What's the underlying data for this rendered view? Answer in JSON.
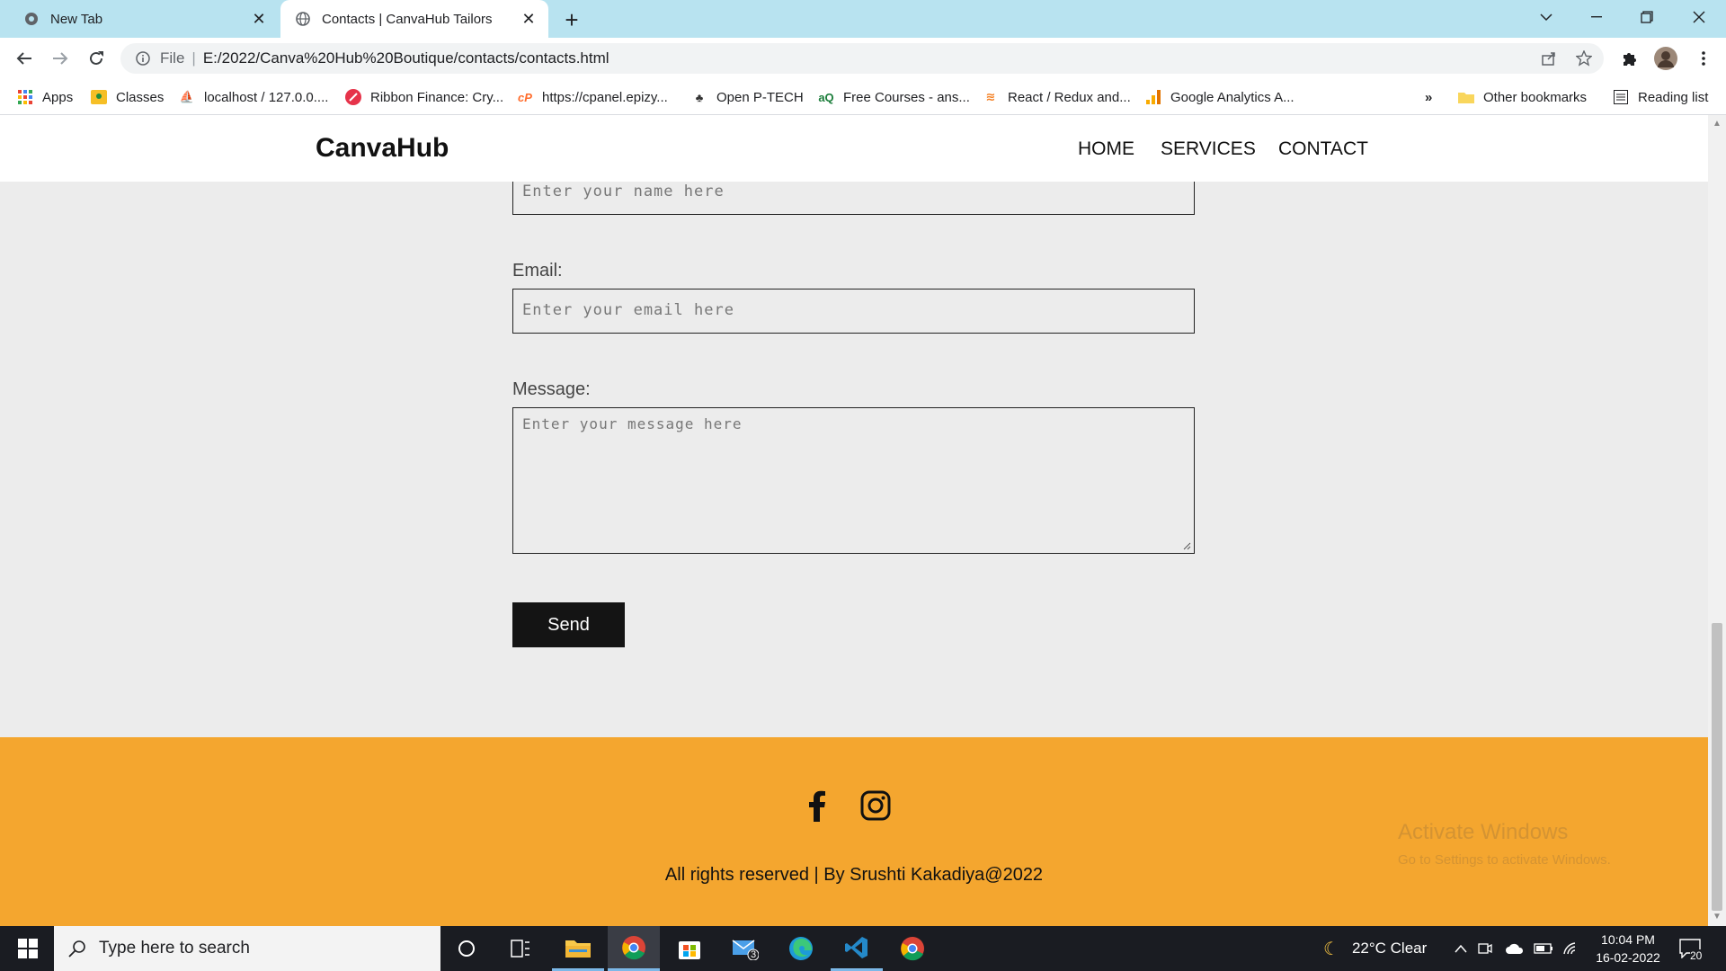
{
  "browser": {
    "tabs": [
      {
        "title": "New Tab",
        "active": false
      },
      {
        "title": "Contacts | CanvaHub Tailors",
        "active": true
      }
    ],
    "omnibox": {
      "scheme": "File",
      "url": "E:/2022/Canva%20Hub%20Boutique/contacts/contacts.html"
    },
    "bookmarks": [
      {
        "label": "Apps",
        "icon": "apps-grid-icon"
      },
      {
        "label": "Classes",
        "icon": "classroom-icon"
      },
      {
        "label": "localhost / 127.0.0....",
        "icon": "phpmyadmin-icon"
      },
      {
        "label": "Ribbon Finance: Cry...",
        "icon": "ribbon-finance-icon"
      },
      {
        "label": "https://cpanel.epizy...",
        "icon": "cpanel-icon"
      },
      {
        "label": "Open P-TECH",
        "icon": "ptech-icon"
      },
      {
        "label": "Free Courses - ans...",
        "icon": "courses-icon"
      },
      {
        "label": "React / Redux and...",
        "icon": "stackoverflow-icon"
      },
      {
        "label": "Google Analytics A...",
        "icon": "analytics-icon"
      }
    ],
    "more_bookmarks": "»",
    "other_bookmarks": "Other bookmarks",
    "reading_list": "Reading list"
  },
  "site": {
    "brand": "CanvaHub",
    "nav": [
      "HOME",
      "SERVICES",
      "CONTACT"
    ],
    "form": {
      "name_placeholder": "Enter your name here",
      "email_label": "Email:",
      "email_placeholder": "Enter your email here",
      "message_label": "Message:",
      "message_placeholder": "Enter your message here",
      "send_label": "Send"
    },
    "footer": {
      "copyright": "All rights reserved | By Srushti Kakadiya@2022",
      "watermark_title": "Activate Windows",
      "watermark_sub": "Go to Settings to activate Windows."
    }
  },
  "taskbar": {
    "search_placeholder": "Type here to search",
    "weather": "22°C  Clear",
    "time": "10:04 PM",
    "date": "16-02-2022",
    "mail_badge": "3",
    "notification_count": "20"
  },
  "colors": {
    "tabbar": "#b8e3f0",
    "page_bg": "#ececec",
    "footer": "#f4a62f",
    "button": "#141414",
    "taskbar": "#1a1c22"
  }
}
